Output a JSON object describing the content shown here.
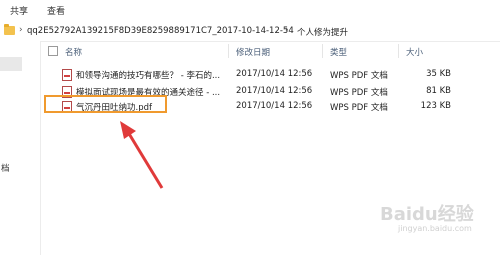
{
  "ribbon": {
    "tabs": [
      "共享",
      "查看"
    ]
  },
  "address": {
    "folder_name": "qq2E52792A139215F8D39E8259889171C7_2017-10-14-12-54",
    "subfolder": "个人修为提升"
  },
  "left_pane": {
    "label": "档"
  },
  "columns": {
    "name": "名称",
    "modified": "修改日期",
    "type": "类型",
    "size": "大小"
  },
  "files": [
    {
      "name": "和领导沟通的技巧有哪些？ - 李石的...",
      "modified": "2017/10/14 12:56",
      "type": "WPS PDF 文档",
      "size": "35 KB"
    },
    {
      "name": "模拟面试现场是最有效的通关途径 - ...",
      "modified": "2017/10/14 12:56",
      "type": "WPS PDF 文档",
      "size": "81 KB"
    },
    {
      "name": "气沉丹田吐纳功.pdf",
      "modified": "2017/10/14 12:56",
      "type": "WPS PDF 文档",
      "size": "123 KB"
    }
  ],
  "watermark": {
    "logo": "Baidu经验",
    "url": "jingyan.baidu.com"
  },
  "colors": {
    "highlight": "#f09a2e",
    "arrow": "#e03a3a"
  }
}
